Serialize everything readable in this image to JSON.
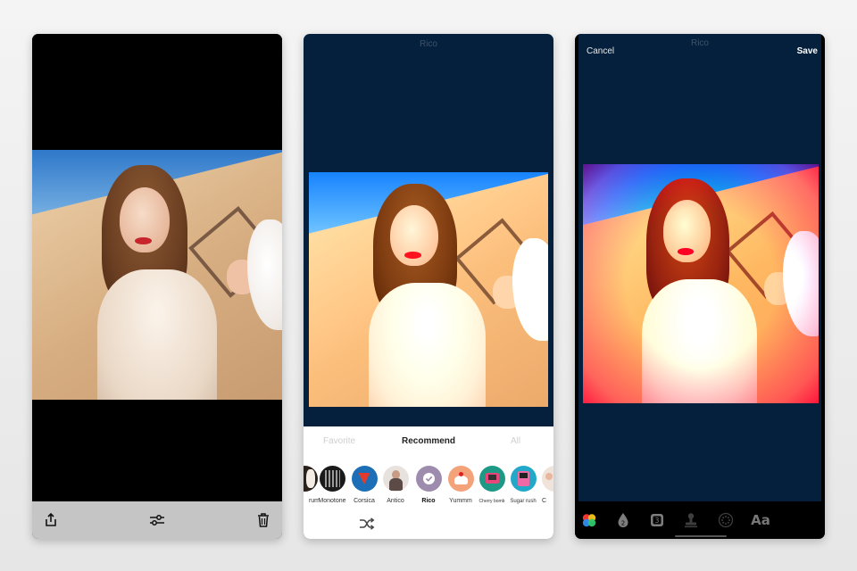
{
  "screen_left": {
    "toolbar": {
      "share_icon": "share-icon",
      "adjust_icon": "sliders-icon",
      "delete_icon": "trash-icon"
    }
  },
  "screen_middle": {
    "nav_title": "Rico",
    "tabs": [
      {
        "label": "Favorite",
        "active": false
      },
      {
        "label": "Recommend",
        "active": true
      },
      {
        "label": "All",
        "active": false
      }
    ],
    "filters": [
      {
        "label": "rum",
        "active": false
      },
      {
        "label": "Monotone",
        "active": false
      },
      {
        "label": "Corsica",
        "active": false
      },
      {
        "label": "Antico",
        "active": false
      },
      {
        "label": "Rico",
        "active": true
      },
      {
        "label": "Yummm",
        "active": false
      },
      {
        "label": "Cherry bomb",
        "active": false
      },
      {
        "label": "Sugar rush",
        "active": false
      },
      {
        "label": "C",
        "active": false
      }
    ],
    "shuffle_icon": "shuffle-icon"
  },
  "screen_right": {
    "nav_title": "Rico",
    "cancel_label": "Cancel",
    "save_label": "Save",
    "tools": [
      {
        "icon": "color-circles-icon"
      },
      {
        "icon": "drop-2-icon",
        "text": "2"
      },
      {
        "icon": "square-3-icon",
        "text": "3"
      },
      {
        "icon": "stamp-icon"
      },
      {
        "icon": "dots-circle-icon"
      },
      {
        "icon": "text-icon",
        "text": "Aa"
      }
    ]
  },
  "colors": {
    "panel_background": "#05203d",
    "toolbar_gray": "#c5c5c5",
    "active_filter": "#9e8cae",
    "frame_accent": "#e53a5a"
  }
}
